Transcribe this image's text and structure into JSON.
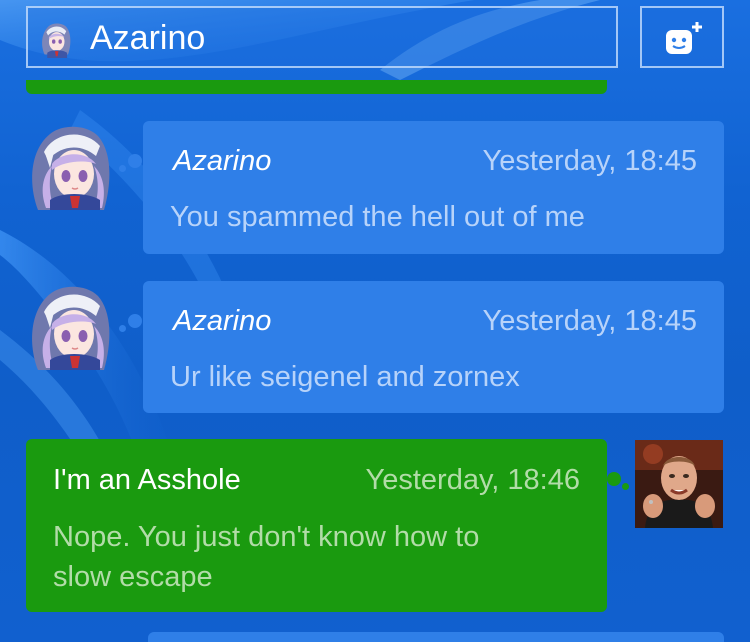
{
  "header": {
    "title": "Azarino",
    "avatar_icon": "anime-girl-avatar-icon",
    "add_button_icon": "add-person-icon"
  },
  "messages": [
    {
      "sender": "Azarino",
      "time": "Yesterday, 18:45",
      "text": "You spammed the hell out of me",
      "side": "left",
      "avatar_icon": "anime-girl-avatar-icon"
    },
    {
      "sender": "Azarino",
      "time": "Yesterday, 18:45",
      "text": "Ur like seigenel and zornex",
      "side": "left",
      "avatar_icon": "anime-girl-avatar-icon"
    },
    {
      "sender": "I'm an Asshole",
      "time": "Yesterday, 18:46",
      "text": "Nope. You just don't know how to\nslow escape",
      "side": "right",
      "avatar_icon": "man-photo-avatar-icon"
    }
  ],
  "colors": {
    "background": "#1160cf",
    "incoming_bubble": "#2f7fe8",
    "outgoing_bubble": "#1a9a0f",
    "incoming_meta_text": "#b7d3fa",
    "outgoing_meta_text": "#b2dca8"
  }
}
